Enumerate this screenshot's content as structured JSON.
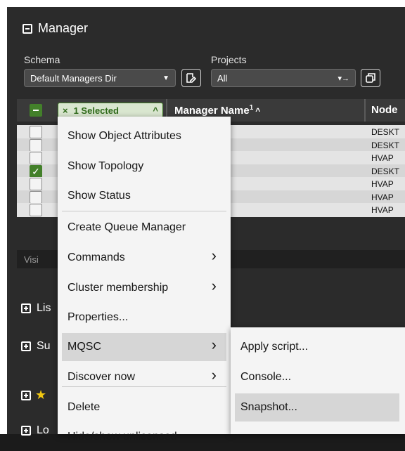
{
  "title": "Manager",
  "schema": {
    "label": "Schema",
    "value": "Default Managers Dir"
  },
  "projects": {
    "label": "Projects",
    "value": "All"
  },
  "selected_chip": "1 Selected",
  "columns": {
    "manager_name": "Manager Name",
    "sort_index": "1",
    "node": "Node"
  },
  "rows": [
    {
      "checked": false,
      "node": "DESKT"
    },
    {
      "checked": false,
      "node": "DESKT"
    },
    {
      "checked": false,
      "node": "HVAP"
    },
    {
      "checked": true,
      "node": "DESKT"
    },
    {
      "checked": false,
      "node": "HVAP"
    },
    {
      "checked": false,
      "node": "HVAP"
    },
    {
      "checked": false,
      "node": "HVAP"
    }
  ],
  "visible_label": "Visi",
  "sections": [
    "Lis",
    "Su",
    "",
    "Lo"
  ],
  "context_menu": {
    "items": [
      {
        "label": "Show Object Attributes",
        "submenu": false
      },
      {
        "label": "Show Topology",
        "submenu": false
      },
      {
        "label": "Show Status",
        "submenu": false
      },
      {
        "label": "Create Queue Manager",
        "submenu": false
      },
      {
        "label": "Commands",
        "submenu": true
      },
      {
        "label": "Cluster membership",
        "submenu": true
      },
      {
        "label": "Properties...",
        "submenu": false
      },
      {
        "label": "MQSC",
        "submenu": true,
        "highlighted": true
      },
      {
        "label": "Discover now",
        "submenu": true
      },
      {
        "label": "Delete",
        "submenu": false
      },
      {
        "label": "Hide/show unlicensed",
        "submenu": false
      }
    ]
  },
  "mqsc_submenu": {
    "items": [
      {
        "label": "Apply script..."
      },
      {
        "label": "Console..."
      },
      {
        "label": "Snapshot...",
        "highlighted": true
      }
    ]
  },
  "colors": {
    "accent_green": "#43802a",
    "star": "#f2c811",
    "panel": "#2b2b2b"
  }
}
